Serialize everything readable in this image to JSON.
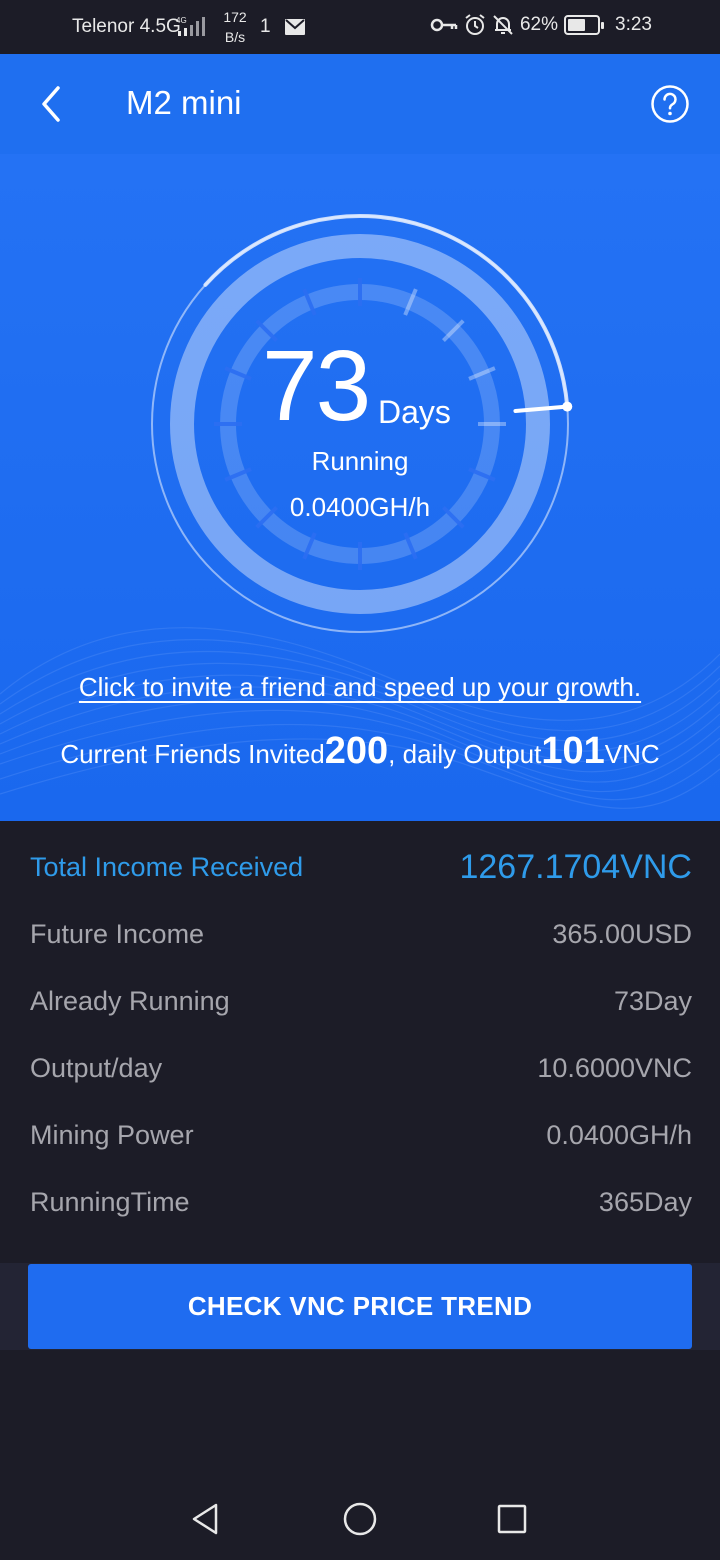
{
  "status_bar": {
    "carrier": "Telenor 4.5G",
    "network_speed_value": "172",
    "network_speed_unit": "B/s",
    "usb_indicator": "1",
    "battery_percent": "62%",
    "battery_level": 0.62,
    "time": "3:23",
    "icons": [
      "signal-icon",
      "mail-icon",
      "key-icon",
      "alarm-icon",
      "bell-off-icon",
      "battery-icon"
    ]
  },
  "header": {
    "title": "M2 mini",
    "back_icon": "chevron-left-icon",
    "help_icon": "help-circle-icon"
  },
  "gauge": {
    "days_value": "73",
    "days_label": "Days",
    "status": "Running",
    "rate": "0.0400GH/h",
    "progress": 0.2
  },
  "invite_link": "Click to invite a friend and speed up your growth.",
  "friends": {
    "prefix": "Current Friends Invited",
    "count": "200",
    "middle": ", daily Output",
    "output": "101",
    "unit": "VNC"
  },
  "info": {
    "rows": [
      {
        "label": "Total Income Received",
        "value": "1267.1704VNC"
      },
      {
        "label": "Future Income",
        "value": "365.00USD"
      },
      {
        "label": "Already Running",
        "value": "73Day"
      },
      {
        "label": "Output/day",
        "value": "10.6000VNC"
      },
      {
        "label": "Mining Power",
        "value": "0.0400GH/h"
      },
      {
        "label": "RunningTime",
        "value": "365Day"
      }
    ]
  },
  "action_button": "CHECK VNC PRICE TREND",
  "nav": [
    "back-triangle-icon",
    "home-circle-icon",
    "recents-square-icon"
  ],
  "colors": {
    "hero_blue": "#1e6ef2",
    "dark_bg": "#1c1c27",
    "accent_blue": "#2f9bea",
    "muted_text": "#a6a6ad",
    "button_blue": "#1f6cf0"
  }
}
